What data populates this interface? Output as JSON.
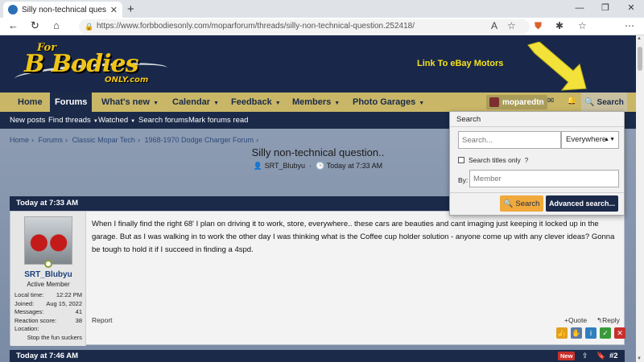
{
  "browser": {
    "tab_title": "Silly non-technical question.. | Fo",
    "tab_close": "✕",
    "new_tab": "+",
    "url": "https://www.forbbodiesonly.com/moparforum/threads/silly-non-technical-question.252418/"
  },
  "site": {
    "logo_for": "For",
    "logo_bbodies": "B Bodies",
    "logo_only": "ONLY.com",
    "ebay_link": "Link To eBay Motors"
  },
  "mainnav": {
    "home": "Home",
    "forums": "Forums",
    "whats_new": "What's new",
    "calendar": "Calendar",
    "feedback": "Feedback",
    "members": "Members",
    "photo_garages": "Photo Garages",
    "username": "moparedtn",
    "search": "Search"
  },
  "subnav": {
    "new_posts": "New posts",
    "find_threads": "Find threads",
    "watched": "Watched",
    "search_forums": "Search forums",
    "mark_read": "Mark forums read"
  },
  "breadcrumbs": [
    "Home",
    "Forums",
    "Classic Mopar Tech",
    "1968-1970 Dodge Charger Forum"
  ],
  "thread": {
    "title": "Silly non-technical question..",
    "author": "SRT_Blubyu",
    "date": "Today at 7:33 AM"
  },
  "post": {
    "header": "Today at 7:33 AM",
    "username": "SRT_Blubyu",
    "user_title": "Active Member",
    "stats": {
      "local_time_label": "Local time:",
      "local_time": "12:22 PM",
      "joined_label": "Joined:",
      "joined": "Aug 15, 2022",
      "messages_label": "Messages:",
      "messages": "41",
      "reaction_label": "Reaction score:",
      "reaction": "38",
      "location_label": "Location:",
      "location": "Stop the fun suckers"
    },
    "body": "When I finally find the right 68' I plan on driving it to work, store, everywhere.. these cars are beauties and cant imaging just keeping it locked up in the garage. But as I was walking in to work the other day I was thinking what is the Coffee cup holder solution - anyone come up with any clever ideas? Gonna be tough to hold it if I succeed in finding a 4spd.",
    "report": "Report",
    "quote": "+Quote",
    "reply": "Reply"
  },
  "post2": {
    "header": "Today at 7:46 AM",
    "badge": "New",
    "number": "#2"
  },
  "search_popup": {
    "title": "Search",
    "placeholder": "Search...",
    "scope": "Everywhere",
    "titles_only": "Search titles only",
    "by_label": "By:",
    "member_placeholder": "Member",
    "search_button": "Search",
    "advanced_button": "Advanced search..."
  }
}
